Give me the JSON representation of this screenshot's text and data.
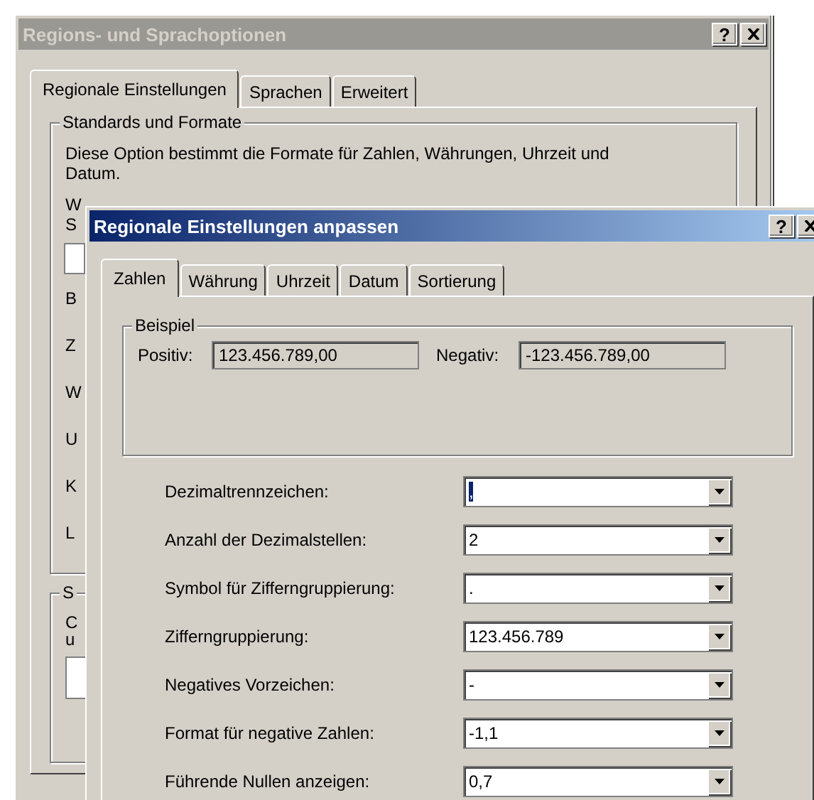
{
  "back_window": {
    "title": "Regions- und Sprachoptionen",
    "help": "?",
    "tabs": [
      {
        "label": "Regionale Einstellungen",
        "selected": true
      },
      {
        "label": "Sprachen",
        "selected": false
      },
      {
        "label": "Erweitert",
        "selected": false
      }
    ],
    "group": {
      "title": "Standards und Formate",
      "description": "Diese Option bestimmt die Formate für Zahlen, Währungen, Uhrzeit und Datum.",
      "lines": [
        "W",
        "S"
      ],
      "labels": [
        "B",
        "Z",
        "W",
        "U",
        "K",
        "L"
      ]
    },
    "group2": {
      "title": "S",
      "lines": [
        "C",
        "u"
      ]
    }
  },
  "dialog": {
    "title": "Regionale Einstellungen anpassen",
    "help": "?",
    "tabs": [
      {
        "label": "Zahlen",
        "selected": true
      },
      {
        "label": "Währung",
        "selected": false
      },
      {
        "label": "Uhrzeit",
        "selected": false
      },
      {
        "label": "Datum",
        "selected": false
      },
      {
        "label": "Sortierung",
        "selected": false
      }
    ],
    "example": {
      "title": "Beispiel",
      "positive_label": "Positiv:",
      "positive": "123.456.789,00",
      "negative_label": "Negativ:",
      "negative": "-123.456.789,00"
    },
    "settings": [
      {
        "label": "Dezimaltrennzeichen:",
        "value": ",",
        "highlighted": true
      },
      {
        "label": "Anzahl der Dezimalstellen:",
        "value": "2",
        "highlighted": false
      },
      {
        "label": "Symbol für Zifferngruppierung:",
        "value": ".",
        "highlighted": false
      },
      {
        "label": "Zifferngruppierung:",
        "value": "123.456.789",
        "highlighted": false
      },
      {
        "label": "Negatives Vorzeichen:",
        "value": "-",
        "highlighted": false
      },
      {
        "label": "Format für negative Zahlen:",
        "value": "-1,1",
        "highlighted": false
      },
      {
        "label": "Führende Nullen anzeigen:",
        "value": "0,7",
        "highlighted": false
      }
    ]
  }
}
